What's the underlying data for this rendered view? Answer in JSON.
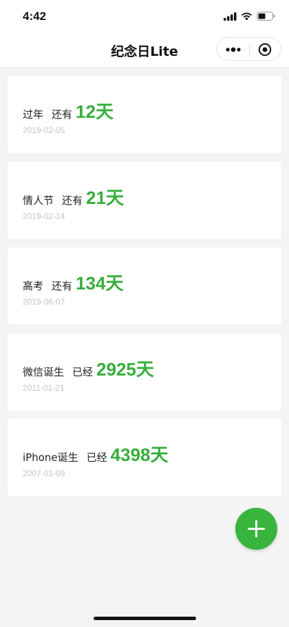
{
  "status_bar": {
    "time": "4:42"
  },
  "nav": {
    "title": "纪念日Lite"
  },
  "events": [
    {
      "name": "过年",
      "verb": "还有",
      "days": "12",
      "unit": "天",
      "date": "2019-02-05"
    },
    {
      "name": "情人节",
      "verb": "还有",
      "days": "21",
      "unit": "天",
      "date": "2019-02-14"
    },
    {
      "name": "高考",
      "verb": "还有",
      "days": "134",
      "unit": "天",
      "date": "2019-06-07"
    },
    {
      "name": "微信诞生",
      "verb": "已经",
      "days": "2925",
      "unit": "天",
      "date": "2011-01-21"
    },
    {
      "name": "iPhone诞生",
      "verb": "已经",
      "days": "4398",
      "unit": "天",
      "date": "2007-01-09"
    }
  ],
  "colors": {
    "accent": "#36ad3c",
    "fab": "#39b53e",
    "background": "#f4f4f4"
  },
  "icons": {
    "add": "plus-icon",
    "more": "more-dots-icon",
    "close": "target-circle-icon"
  }
}
